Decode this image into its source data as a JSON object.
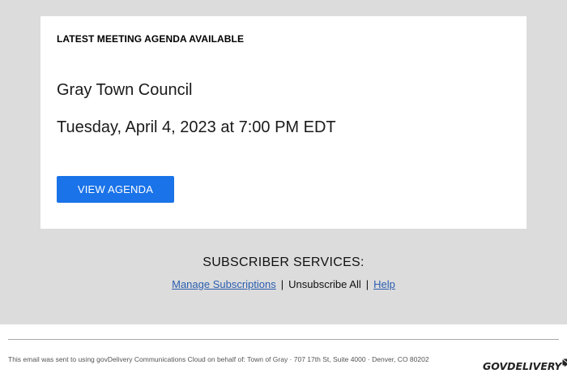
{
  "card": {
    "eyebrow": "LATEST MEETING AGENDA AVAILABLE",
    "org_name": "Gray Town Council",
    "meeting_time": "Tuesday, April 4, 2023 at 7:00 PM EDT",
    "button_label": "VIEW AGENDA"
  },
  "services": {
    "title": "SUBSCRIBER SERVICES:",
    "links": {
      "manage": "Manage Subscriptions",
      "separator1": "|",
      "unsubscribe": "Unsubscribe All",
      "separator2": "|",
      "help": "Help"
    }
  },
  "footer": {
    "text": "This email was sent to using govDelivery Communications Cloud on behalf of: Town of Gray · 707 17th St, Suite 4000 · Denver, CO 80202",
    "logo_text": "GOVDELIVERY",
    "logo_icon": "envelope-icon"
  },
  "colors": {
    "background": "#dcdcdc",
    "card": "#ffffff",
    "button": "#1a73e8",
    "link": "#2a5db0"
  }
}
